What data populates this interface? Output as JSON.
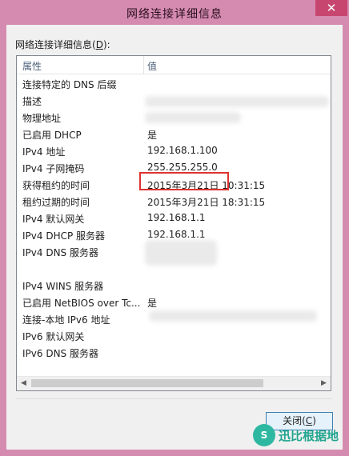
{
  "window": {
    "title": "网络连接详细信息",
    "close_glyph": "✕"
  },
  "caption": {
    "prefix": "网络连接详细信息(",
    "accel": "D",
    "suffix": "):"
  },
  "columns": {
    "property": "属性",
    "value": "值"
  },
  "rows": [
    {
      "property": "连接特定的 DNS 后缀",
      "value": ""
    },
    {
      "property": "描述",
      "value": ""
    },
    {
      "property": "物理地址",
      "value": ""
    },
    {
      "property": "已启用 DHCP",
      "value": "是"
    },
    {
      "property": "IPv4 地址",
      "value": "192.168.1.100"
    },
    {
      "property": "IPv4 子网掩码",
      "value": "255.255.255.0"
    },
    {
      "property": "获得租约的时间",
      "value": "2015年3月21日 10:31:15"
    },
    {
      "property": "租约过期的时间",
      "value": "2015年3月21日 18:31:15"
    },
    {
      "property": "IPv4 默认网关",
      "value": "192.168.1.1"
    },
    {
      "property": "IPv4 DHCP 服务器",
      "value": "192.168.1.1"
    },
    {
      "property": "IPv4 DNS 服务器",
      "value": ""
    },
    {
      "property": "",
      "value": ""
    },
    {
      "property": "IPv4 WINS 服务器",
      "value": ""
    },
    {
      "property": "已启用 NetBIOS over Tc...",
      "value": "是"
    },
    {
      "property": "连接-本地 IPv6 地址",
      "value": ""
    },
    {
      "property": "IPv6 默认网关",
      "value": ""
    },
    {
      "property": "IPv6 DNS 服务器",
      "value": ""
    }
  ],
  "scrollbar": {
    "left_arrow": "◀",
    "right_arrow": "▶"
  },
  "button": {
    "prefix": "关闭(",
    "accel": "C",
    "suffix": ")"
  },
  "watermark": {
    "logo": "S",
    "text": "迅比根据地"
  },
  "colors": {
    "highlight": "#e03131",
    "titlebar": "#d58ab0",
    "accent": "#3c7fb1"
  }
}
